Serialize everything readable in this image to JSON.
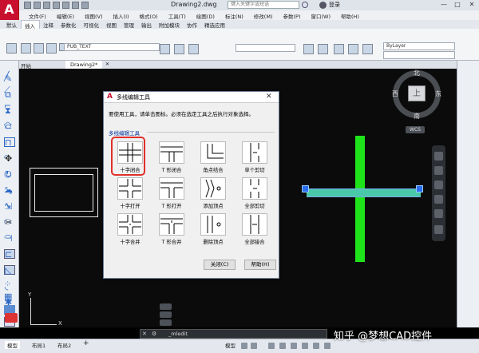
{
  "app": {
    "logo_letter": "A",
    "document_title": "Drawing2.dwg",
    "search_placeholder": "键入关键字或短语",
    "login": "登录"
  },
  "menu": [
    "文件(F)",
    "编辑(E)",
    "视图(V)",
    "插入(I)",
    "格式(O)",
    "工具(T)",
    "绘图(D)",
    "标注(N)",
    "修改(M)",
    "参数(P)",
    "窗口(W)",
    "帮助(H)"
  ],
  "ribbon_tabs": [
    {
      "label": "默认",
      "active": false
    },
    {
      "label": "插入",
      "active": true
    },
    {
      "label": "注释",
      "active": false
    },
    {
      "label": "参数化",
      "active": false
    },
    {
      "label": "可视化",
      "active": false
    },
    {
      "label": "视图",
      "active": false
    },
    {
      "label": "管理",
      "active": false
    },
    {
      "label": "输出",
      "active": false
    },
    {
      "label": "附加模块",
      "active": false
    },
    {
      "label": "协作",
      "active": false
    },
    {
      "label": "精选应用",
      "active": false
    }
  ],
  "ribbon": {
    "layer_value": "PUB_TEXT",
    "property_value": "ByLayer"
  },
  "file_tabs": {
    "start": "开始",
    "drawing": "Drawing2*"
  },
  "viewcube": {
    "north": "北",
    "south": "南",
    "east": "东",
    "west": "西",
    "face": "上",
    "wcs": "WCS"
  },
  "dialog": {
    "title": "多线编辑工具",
    "instructions": "要使用工具，请单击图标。必须在选定工具之后执行对象选择。",
    "group_label": "多线编辑工具",
    "tools": [
      [
        "十字闭合",
        "T 形闭合",
        "角点结合",
        "单个剪切"
      ],
      [
        "十字打开",
        "T 形打开",
        "添加顶点",
        "全部剪切"
      ],
      [
        "十字合并",
        "T 形合并",
        "删除顶点",
        "全部接合"
      ]
    ],
    "close_button": "关闭(C)",
    "help_button": "帮助(H)"
  },
  "ucs": {
    "x": "X",
    "y": "Y"
  },
  "command_line": {
    "text": "_mledit"
  },
  "status": {
    "model": "模型",
    "layout1": "布局1",
    "layout2": "布局2",
    "model_right": "模型"
  },
  "watermark": "知乎 @梦想CAD控件"
}
